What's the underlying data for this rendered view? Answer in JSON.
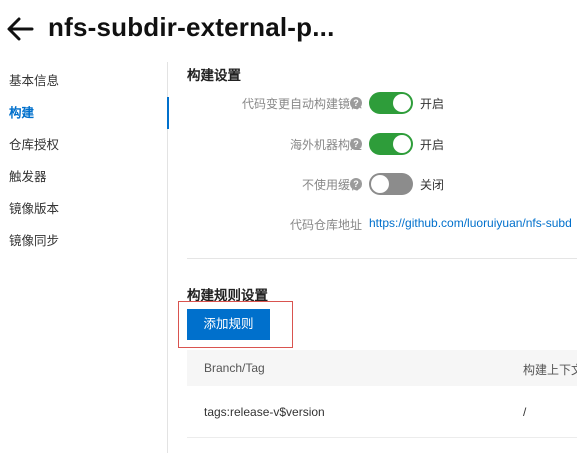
{
  "header": {
    "title": "nfs-subdir-external-p..."
  },
  "sidebar": {
    "items": [
      {
        "label": "基本信息",
        "active": false
      },
      {
        "label": "构建",
        "active": true
      },
      {
        "label": "仓库授权",
        "active": false
      },
      {
        "label": "触发器",
        "active": false
      },
      {
        "label": "镜像版本",
        "active": false
      },
      {
        "label": "镜像同步",
        "active": false
      }
    ]
  },
  "build_settings": {
    "title": "构建设置",
    "auto_build": {
      "label": "代码变更自动构建镜像",
      "status": "开启",
      "on": true
    },
    "overseas_build": {
      "label": "海外机器构建",
      "status": "开启",
      "on": true
    },
    "no_cache": {
      "label": "不使用缓存",
      "status": "关闭",
      "on": false
    },
    "repo": {
      "label": "代码仓库地址",
      "url": "https://github.com/luoruiyuan/nfs-subd"
    }
  },
  "build_rules": {
    "title": "构建规则设置",
    "add_button": "添加规则",
    "columns": [
      "Branch/Tag",
      "构建上下文"
    ],
    "rows": [
      {
        "branch_tag": "tags:release-v$version",
        "context": "/"
      }
    ]
  },
  "colors": {
    "accent": "#0070cc",
    "toggle_on": "#2e9d3a",
    "toggle_off": "#8c8c8c",
    "highlight": "#d9534f"
  }
}
